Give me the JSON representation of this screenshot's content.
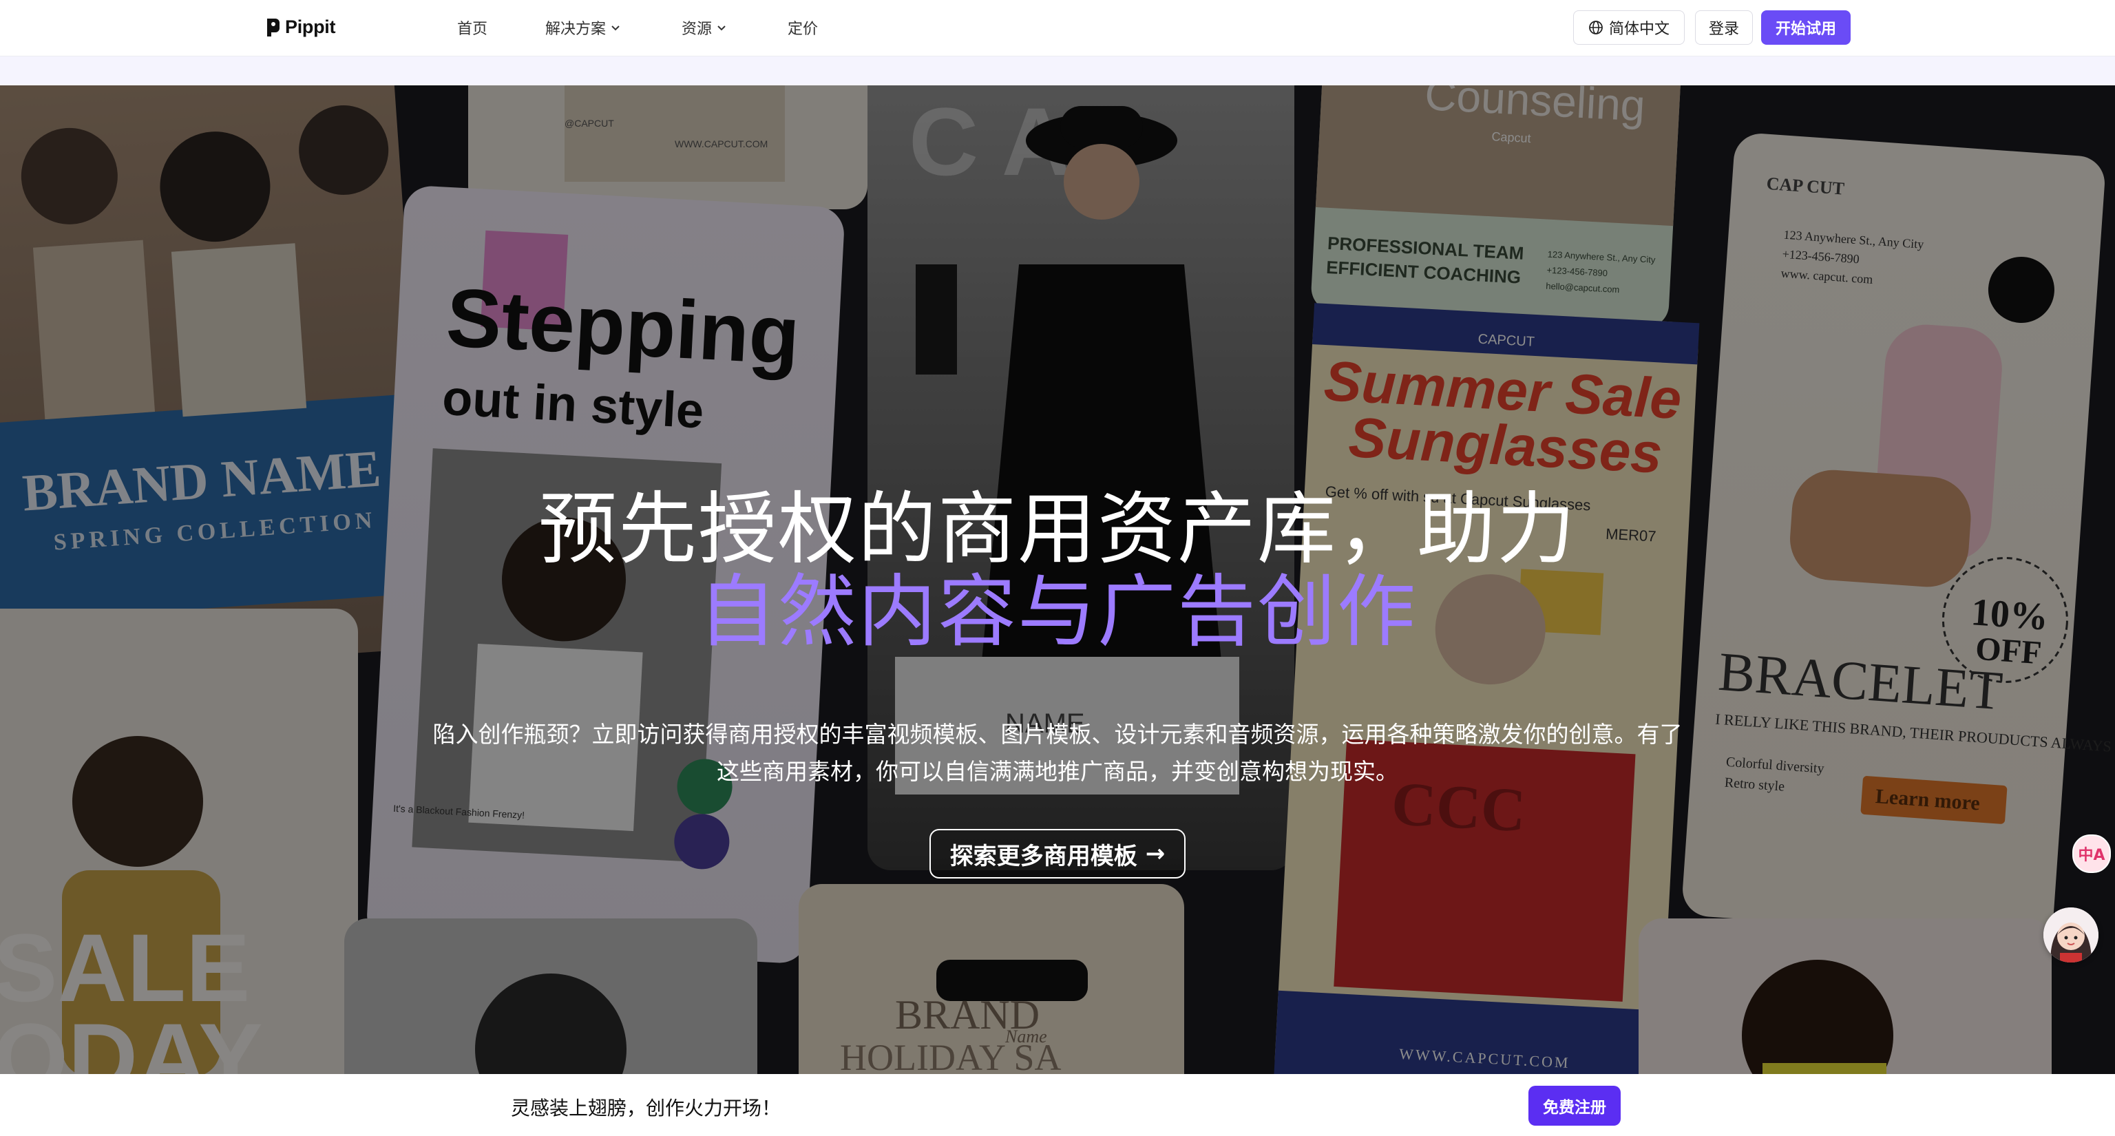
{
  "nav": {
    "logo_text": "Pippit",
    "items": [
      {
        "label": "首页",
        "has_dropdown": false
      },
      {
        "label": "解决方案",
        "has_dropdown": true
      },
      {
        "label": "资源",
        "has_dropdown": true
      },
      {
        "label": "定价",
        "has_dropdown": false
      }
    ],
    "language_label": "简体中文",
    "login_label": "登录",
    "start_label": "开始试用"
  },
  "hero": {
    "title_line1": "预先授权的商用资产库，助力",
    "title_line2": "自然内容与广告创作",
    "description": "陷入创作瓶颈？立即访问获得商用授权的丰富视频模板、图片模板、设计元素和音频资源，运用各种策略激发你的创意。有了这些商用素材，你可以自信满满地推广商品，并变创意构想为现实。",
    "cta_label": "探索更多商用模板",
    "cta_arrow": "→",
    "collage": {
      "card1_brand": "BRAND NAME",
      "card1_sub": "SPRING COLLECTION",
      "card2_title": "Stepping",
      "card2_sub": "out in style",
      "card2_small": "It's a Blackout Fashion Frenzy!",
      "card2_top_left": "@CAPCUT",
      "card2_top_right": "WWW.CAPCUT.COM",
      "card3_sale": "SALE",
      "card3_today": "ODAY",
      "card4_letters": "C A",
      "card4_name": "NAME",
      "card5_title": "Counseling",
      "card5_capcut": "Capcut",
      "card5_team": "PROFESSIONAL TEAM",
      "card5_coaching": "EFFICIENT COACHING",
      "card5_addr": "123 Anywhere St., Any City",
      "card5_phone": "+123-456-7890",
      "card5_mail": "hello@capcut.com",
      "card6_badge": "CAPCUT",
      "card6_title1": "Summer Sale",
      "card6_title2": "Sunglasses",
      "card6_offer": "Get % off with su  at Capcut Sunglasses",
      "card6_code": "MER07",
      "card6_url": "WWW.CAPCUT.COM",
      "card6_shirt": "CCC",
      "card7_brand": "BRAND",
      "card7_name": "Name",
      "card7_holiday": "HOLIDAY SA",
      "card8_cap": "CAP CUT",
      "card8_addr": "123 Anywhere St., Any City",
      "card8_phone": "+123-456-7890",
      "card8_web": "www. capcut. com",
      "card8_discount_top": "10%",
      "card8_discount_bottom": "OFF",
      "card8_title": "BRACELET",
      "card8_quote": "I RELLY LIKE THIS BRAND, THEIR PROUDUCTS ALWAYS SURPRISE ME.",
      "card8_bullet1": "Colorful diversity",
      "card8_bullet2": "Retro style",
      "card8_learn": "Learn more"
    }
  },
  "floating": {
    "translate_icon_text": "中A"
  },
  "bottom_bar": {
    "text": "灵感装上翅膀，创作火力开场！",
    "signup_label": "免费注册"
  },
  "colors": {
    "brand_purple": "#6a4cf6",
    "title_accent": "#9c7bff",
    "signup_purple": "#5b2ef2"
  }
}
